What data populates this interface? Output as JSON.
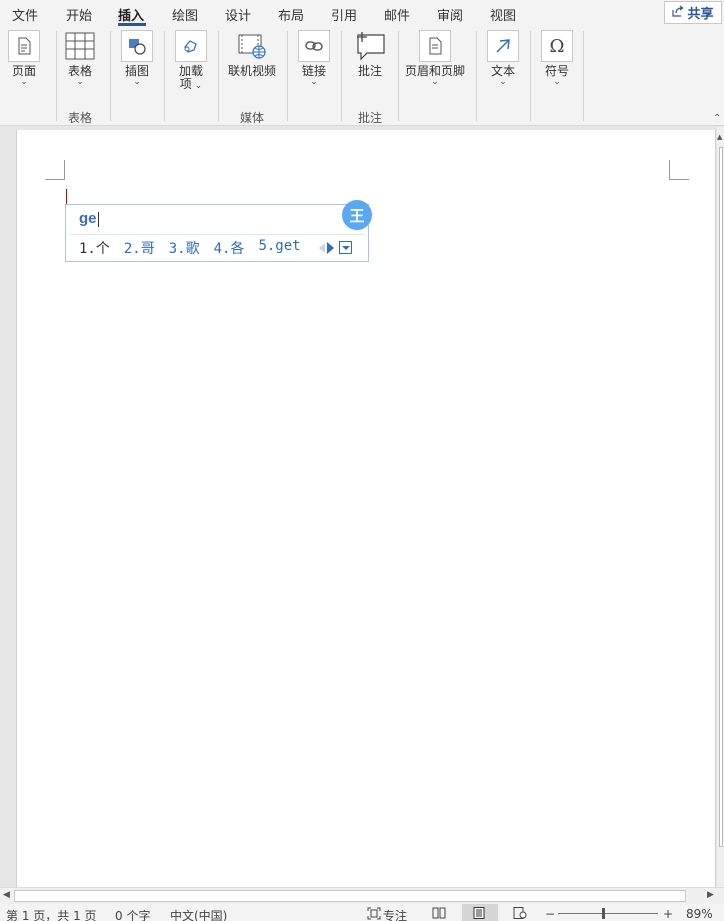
{
  "tabs": [
    {
      "label": "文件"
    },
    {
      "label": "开始"
    },
    {
      "label": "插入"
    },
    {
      "label": "绘图"
    },
    {
      "label": "设计"
    },
    {
      "label": "布局"
    },
    {
      "label": "引用"
    },
    {
      "label": "邮件"
    },
    {
      "label": "审阅"
    },
    {
      "label": "视图"
    }
  ],
  "active_tab": "插入",
  "share": {
    "label": "共享",
    "icon": "share-icon"
  },
  "ribbon": {
    "buttons": [
      {
        "label": "页面",
        "icon": "page-icon",
        "has_dropdown": true
      },
      {
        "label": "表格",
        "icon": "table-icon",
        "has_dropdown": true
      },
      {
        "label": "插图",
        "icon": "illustrations-icon",
        "has_dropdown": true
      },
      {
        "label": "加载",
        "label2": "项",
        "icon": "addins-icon",
        "has_dropdown": true
      },
      {
        "label": "联机视频",
        "icon": "online-video-icon",
        "has_dropdown": false
      },
      {
        "label": "链接",
        "icon": "link-icon",
        "has_dropdown": true
      },
      {
        "label": "批注",
        "icon": "comment-icon",
        "has_dropdown": false
      },
      {
        "label": "页眉和页脚",
        "icon": "header-footer-icon",
        "has_dropdown": true
      },
      {
        "label": "文本",
        "icon": "text-icon",
        "has_dropdown": true
      },
      {
        "label": "符号",
        "icon": "omega-icon",
        "has_dropdown": true
      }
    ],
    "groups": [
      {
        "label": "表格"
      },
      {
        "label": "媒体"
      },
      {
        "label": "批注"
      }
    ]
  },
  "ime": {
    "input": "ge",
    "logo": "王",
    "candidates": [
      "1.个",
      "2.哥",
      "3.歌",
      "4.各",
      "5.get"
    ]
  },
  "status_bar": {
    "page": "第 1 页，共 1 页",
    "words": "0 个字",
    "language": "中文(中国)",
    "focus": "专注",
    "zoom_minus": "−",
    "zoom_plus": "+",
    "zoom": "89%",
    "zoom_fraction": 0.45
  },
  "colors": {
    "accent": "#2b579a",
    "ime_blue": "#2b6cc4",
    "ime_logo": "#5aa7f2",
    "caret": "#cc0000"
  }
}
